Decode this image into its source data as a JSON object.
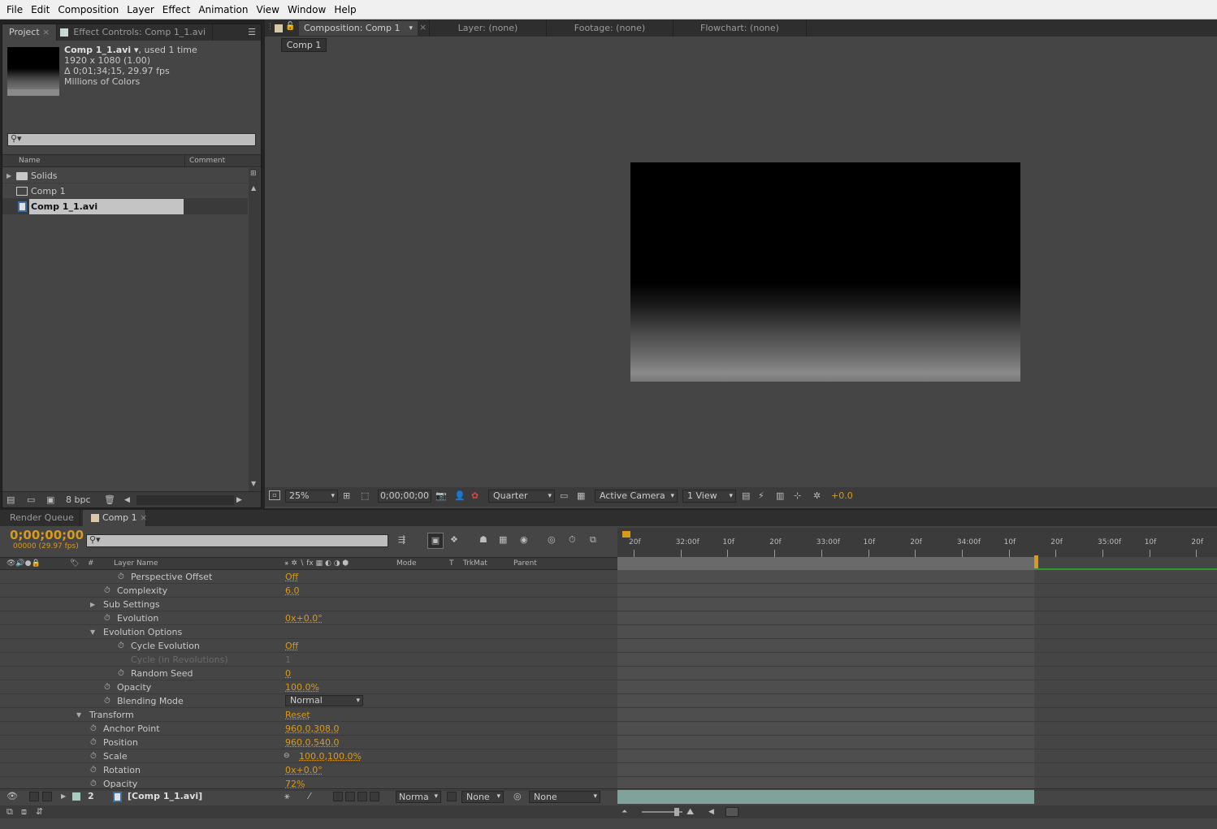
{
  "menu": [
    "File",
    "Edit",
    "Composition",
    "Layer",
    "Effect",
    "Animation",
    "View",
    "Window",
    "Help"
  ],
  "project_panel": {
    "tabs": [
      "Project",
      "Effect Controls: Comp 1_1.avi"
    ],
    "item_name": "Comp 1_1.avi ▾",
    "item_used": ", used 1 time",
    "item_size": "1920 x 1080 (1.00)",
    "item_duration": "Δ 0;01;34;15, 29.97 fps",
    "item_colors": "Millions of Colors",
    "search_placeholder": "",
    "columns": [
      "Name",
      "Comment"
    ],
    "items": [
      {
        "name": "Solids",
        "type": "folder"
      },
      {
        "name": "Comp 1",
        "type": "comp"
      },
      {
        "name": "Comp 1_1.avi",
        "type": "footage",
        "selected": true
      }
    ],
    "bpc": "8 bpc"
  },
  "viewer": {
    "tabs": [
      "Composition: Comp 1",
      "Layer: (none)",
      "Footage: (none)",
      "Flowchart: (none)"
    ],
    "breadcrumb": "Comp 1",
    "zoom": "25%",
    "timecode": "0;00;00;00",
    "resolution": "Quarter",
    "camera": "Active Camera",
    "views": "1 View",
    "exposure": "+0.0"
  },
  "timeline": {
    "tabs": [
      "Render Queue",
      "Comp 1"
    ],
    "timecode": "0;00;00;00",
    "frame_info": "00000 (29.97 fps)",
    "columns": {
      "layer_name": "Layer Name",
      "mode": "Mode",
      "t": "T",
      "trkmat": "TrkMat",
      "parent": "Parent",
      "hash": "#"
    },
    "ruler": [
      "20f",
      "32:00f",
      "10f",
      "20f",
      "33:00f",
      "10f",
      "20f",
      "34:00f",
      "10f",
      "20f",
      "35:00f",
      "10f",
      "20f"
    ],
    "properties": [
      {
        "name": "Perspective Offset",
        "value": "Off",
        "indent": 3,
        "stopwatch": true
      },
      {
        "name": "Complexity",
        "value": "6.0",
        "indent": 2,
        "stopwatch": true
      },
      {
        "name": "Sub Settings",
        "value": "",
        "indent": 1,
        "twirl": "closed"
      },
      {
        "name": "Evolution",
        "value": "0x+0.0°",
        "indent": 2,
        "stopwatch": true
      },
      {
        "name": "Evolution Options",
        "value": "",
        "indent": 1,
        "twirl": "open"
      },
      {
        "name": "Cycle Evolution",
        "value": "Off",
        "indent": 3,
        "stopwatch": true
      },
      {
        "name": "Cycle (in Revolutions)",
        "value": "1",
        "indent": 3,
        "stopwatch": false,
        "disabled": true
      },
      {
        "name": "Random Seed",
        "value": "0",
        "indent": 3,
        "stopwatch": true
      },
      {
        "name": "Opacity",
        "value": "100.0%",
        "indent": 2,
        "stopwatch": true
      },
      {
        "name": "Blending Mode",
        "value": "Normal",
        "indent": 2,
        "stopwatch": true,
        "dropdown": true
      },
      {
        "name": "Transform",
        "value": "Reset",
        "indent": 0,
        "twirl": "open"
      },
      {
        "name": "Anchor Point",
        "value": "960.0,308.0",
        "indent": 1,
        "stopwatch": true
      },
      {
        "name": "Position",
        "value": "960.0,540.0",
        "indent": 1,
        "stopwatch": true
      },
      {
        "name": "Scale",
        "value": "100.0,100.0%",
        "indent": 1,
        "stopwatch": true,
        "link": true
      },
      {
        "name": "Rotation",
        "value": "0x+0.0°",
        "indent": 1,
        "stopwatch": true
      },
      {
        "name": "Opacity",
        "value": "72%",
        "indent": 1,
        "stopwatch": true
      }
    ],
    "layer": {
      "number": "2",
      "name": "[Comp 1_1.avi]",
      "mode": "Norma",
      "trkmat": "None",
      "parent": "None"
    }
  },
  "colors": {
    "accent": "#d99a1b",
    "panel": "#454545",
    "layer_bar": "#7fa39b",
    "work_area": "#2a9a2a"
  }
}
